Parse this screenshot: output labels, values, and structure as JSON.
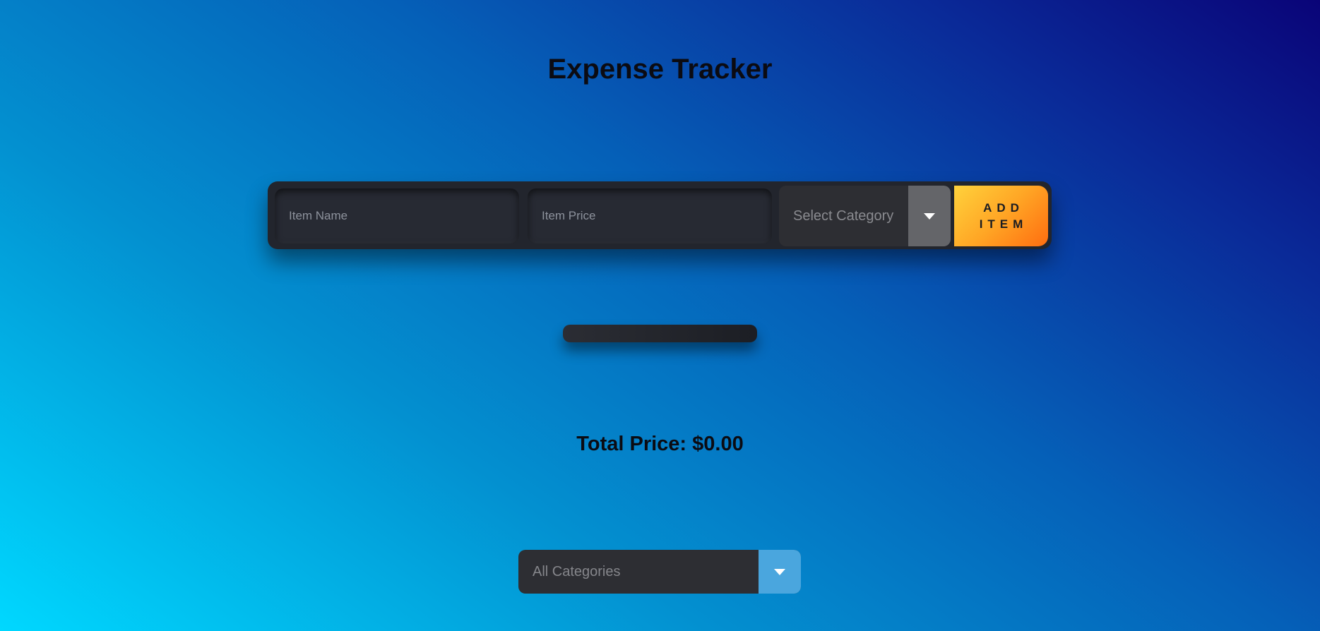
{
  "header": {
    "title": "Expense Tracker"
  },
  "form": {
    "item_name_placeholder": "Item Name",
    "item_price_placeholder": "Item Price",
    "category_select": {
      "selected": "Select Category"
    },
    "add_button_label": "ADD\nITEM"
  },
  "summary": {
    "total_label": "Total Price: $0.00"
  },
  "filter": {
    "selected": "All Categories"
  },
  "icons": {
    "category_dropdown": "caret-down-icon",
    "filter_dropdown": "caret-down-icon"
  },
  "colors": {
    "add_button_gradient_start": "#ffd23c",
    "add_button_gradient_end": "#ff6d10",
    "panel_dark": "#22252d",
    "filter_arrow_bg": "#4aa6de"
  }
}
